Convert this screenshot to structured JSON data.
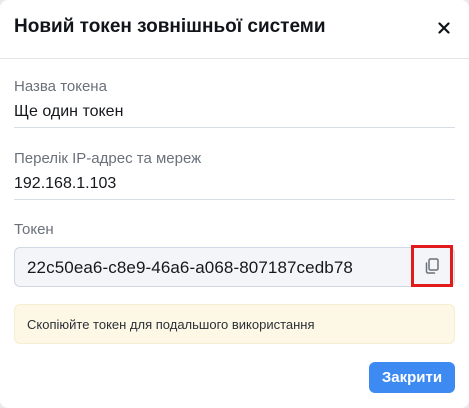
{
  "dialog": {
    "title": "Новий токен зовнішньої системи",
    "close_icon": "close-icon"
  },
  "fields": {
    "token_name": {
      "label": "Назва токена",
      "value": "Ще один токен"
    },
    "ip_list": {
      "label": "Перелік IP-адрес та мереж",
      "value": "192.168.1.103"
    },
    "token": {
      "label": "Токен",
      "value": "22c50ea6-c8e9-46a6-a068-807187cedb78",
      "copy_icon": "copy-icon"
    }
  },
  "notice": {
    "text": "Скопіюйте токен для подальшого використання"
  },
  "actions": {
    "close_label": "Закрити"
  },
  "colors": {
    "primary": "#3d8bf2",
    "highlight": "#e11b1b",
    "notice_bg": "#fdf8e6"
  }
}
